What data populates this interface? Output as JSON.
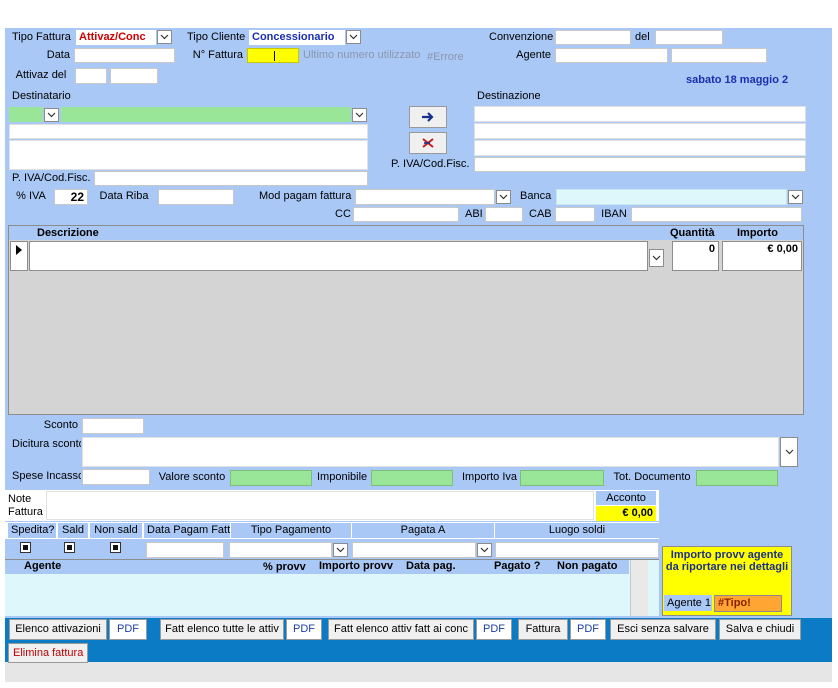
{
  "header": {
    "tipo_fattura_label": "Tipo Fattura",
    "tipo_fattura_value": "Attivaz/Conc",
    "tipo_cliente_label": "Tipo Cliente",
    "tipo_cliente_value": "Concessionario",
    "convenzione_label": "Convenzione",
    "del_label": "del",
    "data_label": "Data",
    "n_fattura_label": "N° Fattura",
    "ultimo_numero_text": "Ultimo numero utilizzato",
    "errore_text": "#Errore",
    "agente_label": "Agente",
    "attivaz_del_label": "Attivaz del",
    "date_display": "sabato 18 maggio 2"
  },
  "destinatario": {
    "label": "Destinatario",
    "piva_label": "P. IVA/Cod.Fisc."
  },
  "destinazione": {
    "label": "Destinazione",
    "piva_label": "P. IVA/Cod.Fisc."
  },
  "payment": {
    "iva_label": "% IVA",
    "iva_value": "22",
    "data_riba_label": "Data Riba",
    "mod_pagam_label": "Mod pagam fattura",
    "banca_label": "Banca",
    "cc_label": "CC",
    "abi_label": "ABI",
    "cab_label": "CAB",
    "iban_label": "IBAN"
  },
  "lines": {
    "descrizione_header": "Descrizione",
    "quantita_header": "Quantità",
    "importo_header": "Importo",
    "row_quantita": "0",
    "row_importo": "€ 0,00"
  },
  "totals": {
    "sconto_label": "Sconto",
    "dicitura_sconto_label": "Dicitura sconto",
    "spese_incasso_label": "Spese Incasso",
    "valore_sconto_label": "Valore sconto",
    "imponibile_label": "Imponibile",
    "importo_iva_label": "Importo Iva",
    "tot_documento_label": "Tot. Documento"
  },
  "notes": {
    "note_label_1": "Note",
    "note_label_2": "Fattura",
    "acconto_label": "Acconto",
    "acconto_value": "€ 0,00"
  },
  "status": {
    "spedita_label": "Spedita?",
    "sald_label": "Sald",
    "non_sald_label": "Non sald",
    "data_pagam_label": "Data Pagam Fatt",
    "tipo_pagamento_label": "Tipo Pagamento",
    "pagata_a_label": "Pagata A",
    "luogo_soldi_label": "Luogo soldi"
  },
  "agents": {
    "agente_header": "Agente",
    "provv_header": "% provv",
    "importo_provv_header": "Importo provv",
    "data_pag_header": "Data pag.",
    "pagato_header": "Pagato ?",
    "non_pagato_header": "Non pagato",
    "box_title": "Importo provv agente da riportare nei dettagli",
    "agente1_label": "Agente 1",
    "agente1_value": "#Tipo!"
  },
  "footer": {
    "elenco_attivazioni": "Elenco attivazioni",
    "pdf": "PDF",
    "fatt_elenco_tutte": "Fatt elenco tutte le attiv",
    "fatt_elenco_conc": "Fatt elenco attiv fatt ai conc",
    "fattura": "Fattura",
    "esci_senza_salvare": "Esci senza salvare",
    "salva_e_chiudi": "Salva e chiudi",
    "elimina_fattura": "Elimina fattura"
  },
  "colors": {
    "label_bg": "#a9c8f5",
    "form_bg": "#a9c8f5",
    "footer_bg": "#0a7bc4",
    "red_text": "#d00000",
    "blue_text": "#1a2fb0",
    "yellow": "#ffff00",
    "green": "#99e699"
  },
  "icons": {
    "arrow_right": "arrow-right-icon",
    "delete_cross": "delete-cross-icon",
    "dropdown": "chevron-down-icon",
    "record_selector": "record-pointer-icon"
  }
}
